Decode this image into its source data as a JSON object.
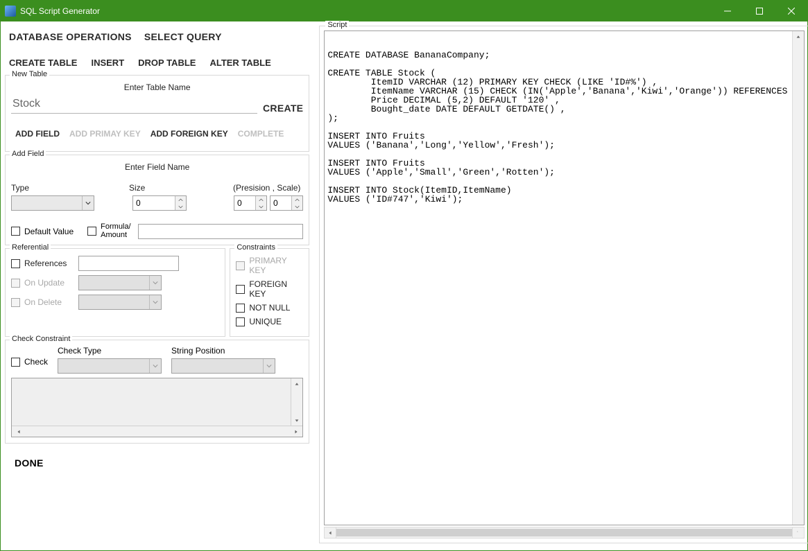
{
  "window": {
    "title": "SQL Script Generator"
  },
  "top_tabs": {
    "database_operations": "DATABASE OPERATIONS",
    "select_query": "SELECT QUERY"
  },
  "sub_tabs": {
    "create_table": "CREATE TABLE",
    "insert": "INSERT",
    "drop_table": "DROP TABLE",
    "alter_table": "ALTER TABLE"
  },
  "new_table": {
    "legend": "New Table",
    "enter_table_name": "Enter Table Name",
    "table_name_value": "Stock",
    "create": "CREATE",
    "tabs": {
      "add_field": "ADD FIELD",
      "add_primary_key": "ADD PRIMAY KEY",
      "add_foreign_key": "ADD FOREIGN KEY",
      "complete": "COMPLETE"
    }
  },
  "add_field": {
    "legend": "Add Field",
    "enter_field_name": "Enter Field Name",
    "type": "Type",
    "size": "Size",
    "precision_scale": "(Presision , Scale)",
    "size_value": "0",
    "precision_value": "0",
    "scale_value": "0",
    "default_value": "Default Value",
    "formula_amount": "Formula/\nAmount"
  },
  "referential": {
    "legend": "Referential",
    "references": "References",
    "on_update": "On Update",
    "on_delete": "On Delete"
  },
  "constraints": {
    "legend": "Constraints",
    "primary_key": "PRIMARY KEY",
    "foreign_key": "FOREIGN KEY",
    "not_null": "NOT NULL",
    "unique": "UNIQUE"
  },
  "check_constraint": {
    "legend": "Check Constraint",
    "check": "Check",
    "check_type": "Check Type",
    "string_position": "String Position"
  },
  "done": "DONE",
  "script": {
    "legend": "Script",
    "content": "CREATE DATABASE BananaCompany;\n\nCREATE TABLE Stock (\n        ItemID VARCHAR (12) PRIMARY KEY CHECK (LIKE 'ID#%') ,\n        ItemName VARCHAR (15) CHECK (IN('Apple','Banana','Kiwi','Orange')) REFERENCES\n        Price DECIMAL (5,2) DEFAULT '120' ,\n        Bought_date DATE DEFAULT GETDATE() ,\n);\n\nINSERT INTO Fruits\nVALUES ('Banana','Long','Yellow','Fresh');\n\nINSERT INTO Fruits\nVALUES ('Apple','Small','Green','Rotten');\n\nINSERT INTO Stock(ItemID,ItemName)\nVALUES ('ID#747','Kiwi');"
  }
}
